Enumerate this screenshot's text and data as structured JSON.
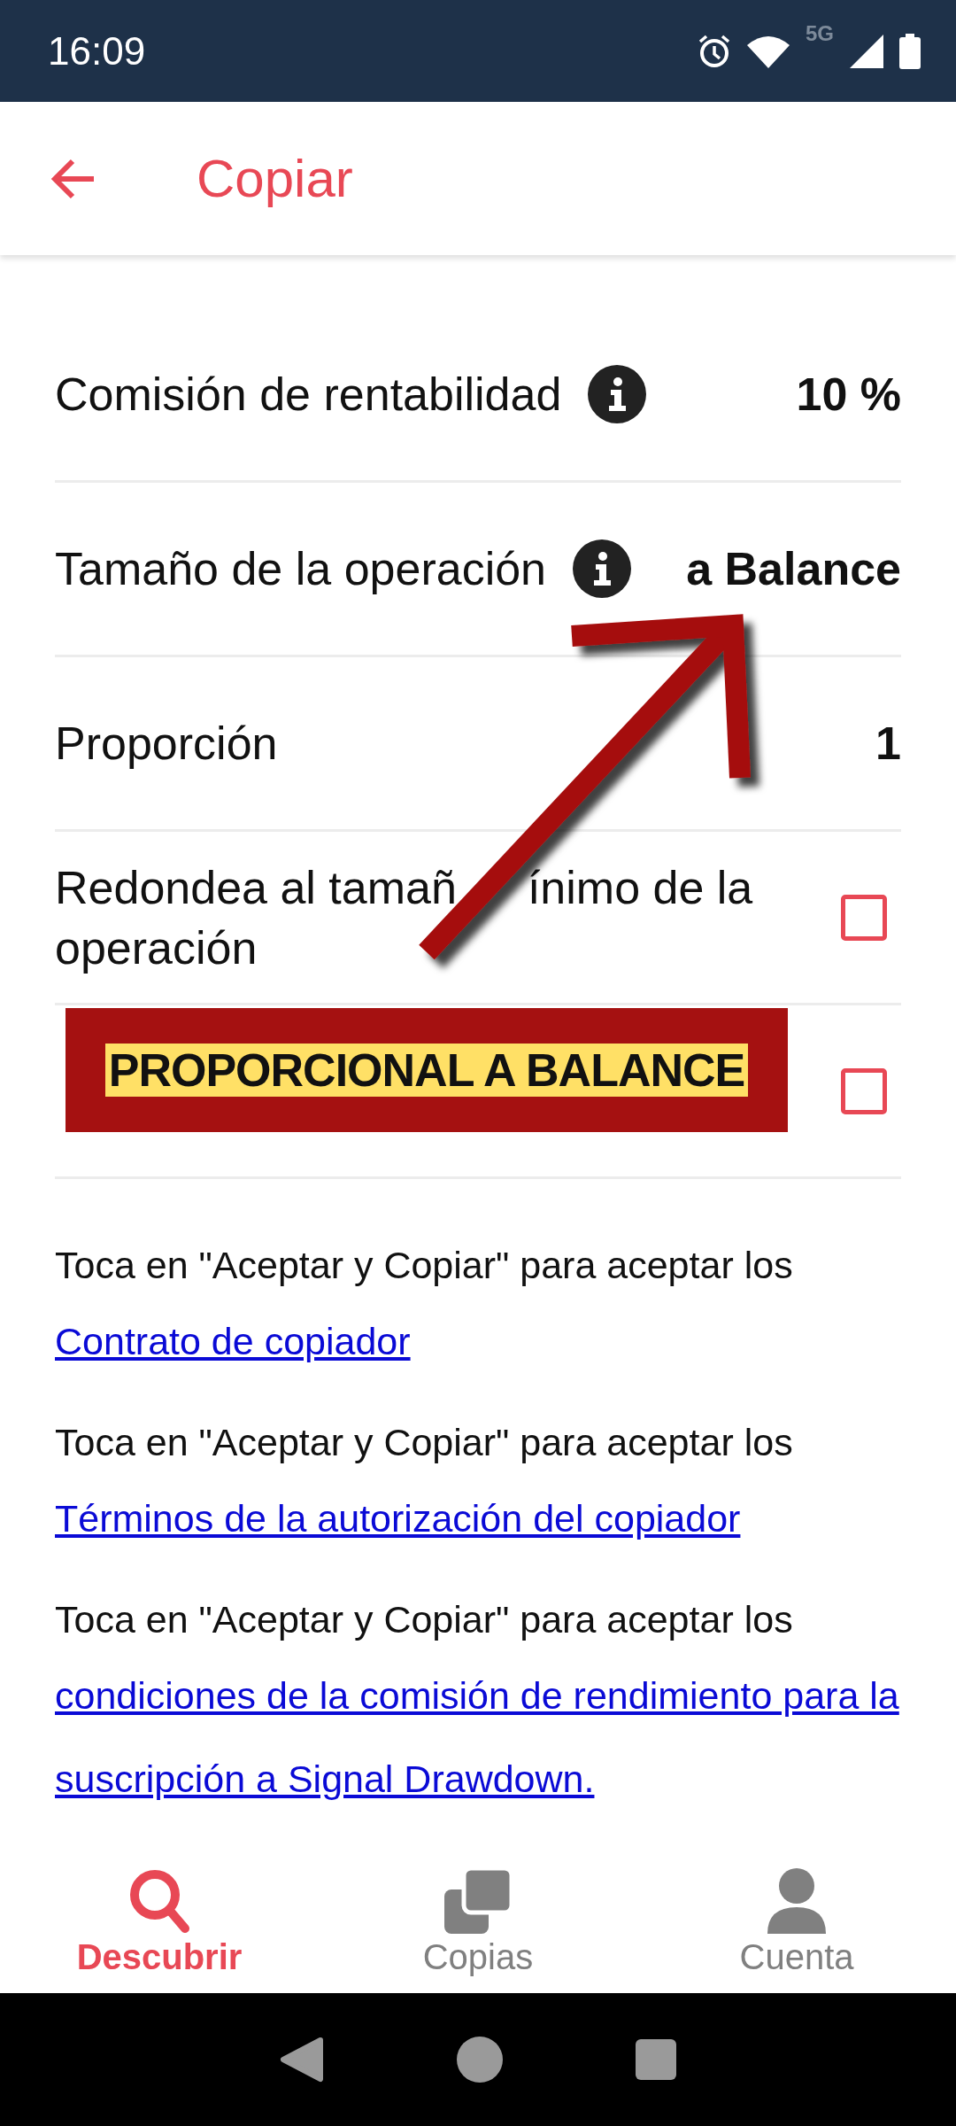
{
  "status_bar": {
    "time": "16:09",
    "network": "5G"
  },
  "app_bar": {
    "title": "Copiar"
  },
  "settings": [
    {
      "kind": "value",
      "label": "Comisión de rentabilidad",
      "info": true,
      "value": "10 %"
    },
    {
      "kind": "value",
      "label": "Tamaño de la operación",
      "info": true,
      "value": "a Balance"
    },
    {
      "kind": "value",
      "label": "Proporción",
      "info": false,
      "value": "1"
    },
    {
      "kind": "checkbox",
      "label_lines": [
        [
          "Redondea al tamañ",
          "ínimo de la"
        ],
        [
          "operación"
        ]
      ],
      "checked": false
    },
    {
      "kind": "checkbox",
      "checked": false
    }
  ],
  "agreements": [
    {
      "text": "Toca en \"Aceptar y Copiar\" para aceptar los",
      "link": "Contrato de copiador"
    },
    {
      "text": "Toca en \"Aceptar y Copiar\" para aceptar los",
      "link": "Términos de la autorización del copiador"
    },
    {
      "text": "Toca en \"Aceptar y Copiar\" para aceptar los",
      "link": "condiciones de la comisión de rendimiento para la suscripción a Signal Drawdown."
    }
  ],
  "annotation": {
    "text": "PROPORCIONAL A BALANCE"
  },
  "bottom_nav": [
    {
      "label": "Descubrir",
      "selected": true
    },
    {
      "label": "Copias",
      "selected": false
    },
    {
      "label": "Cuenta",
      "selected": false
    }
  ]
}
